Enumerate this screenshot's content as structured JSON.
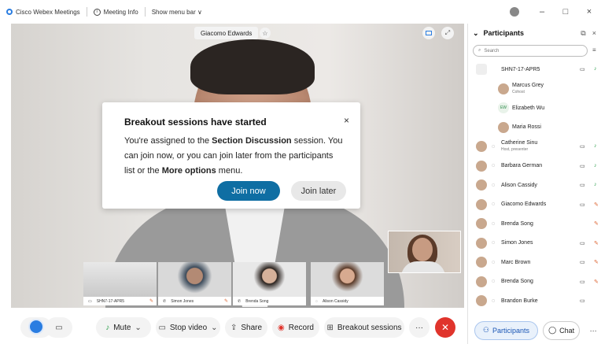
{
  "titlebar": {
    "app_name": "Cisco Webex Meetings",
    "meeting_info": "Meeting Info",
    "show_menu_bar": "Show menu bar ∨",
    "minimize": "–",
    "maximize": "□",
    "close": "×"
  },
  "stage": {
    "speaker_name": "Giacomo Edwards"
  },
  "modal": {
    "title": "Breakout sessions have started",
    "body_pre": "You're assigned to the ",
    "body_session": "Section Discussion",
    "body_mid": " session. You can join now, or you can join later from the participants list or the ",
    "body_more": "More options",
    "body_post": " menu.",
    "join_now": "Join now",
    "join_later": "Join later",
    "close": "×"
  },
  "thumbnails": [
    {
      "label": "SHN7-17-APR5"
    },
    {
      "label": "Simon Jones"
    },
    {
      "label": "Brenda Song"
    },
    {
      "label": "Alison Cassidy"
    }
  ],
  "controls": {
    "mute": "Mute",
    "stop_video": "Stop video",
    "share": "Share",
    "record": "Record",
    "breakout": "Breakout sessions",
    "more": "···",
    "end": "✕"
  },
  "panel": {
    "title": "Participants",
    "search_placeholder": "Search",
    "participants": [
      {
        "name": "SHN7-17-APR5",
        "sub": "",
        "type": "device",
        "video": true,
        "mic": "on"
      },
      {
        "name": "Marcus Grey",
        "sub": "Cohost",
        "type": "child",
        "video": false,
        "mic": ""
      },
      {
        "name": "Elizabeth Wu",
        "sub": "",
        "type": "child-init",
        "initials": "EW",
        "video": false,
        "mic": ""
      },
      {
        "name": "Maria Rossi",
        "sub": "",
        "type": "child",
        "video": false,
        "mic": ""
      },
      {
        "name": "Catherine Sinu",
        "sub": "Host, presenter",
        "type": "person",
        "video": true,
        "mic": "on"
      },
      {
        "name": "Barbara German",
        "sub": "",
        "type": "person",
        "video": true,
        "mic": "on"
      },
      {
        "name": "Alison Cassidy",
        "sub": "",
        "type": "person",
        "video": true,
        "mic": "on"
      },
      {
        "name": "Giacomo Edwards",
        "sub": "",
        "type": "person",
        "video": true,
        "mic": "off"
      },
      {
        "name": "Brenda Song",
        "sub": "",
        "type": "person",
        "video": false,
        "mic": "off"
      },
      {
        "name": "Simon Jones",
        "sub": "",
        "type": "person",
        "video": true,
        "mic": "off"
      },
      {
        "name": "Marc Brown",
        "sub": "",
        "type": "person",
        "video": true,
        "mic": "off"
      },
      {
        "name": "Brenda Song",
        "sub": "",
        "type": "person",
        "video": true,
        "mic": "off"
      },
      {
        "name": "Brandon Burke",
        "sub": "",
        "type": "person",
        "video": true,
        "mic": ""
      }
    ],
    "footer": {
      "participants": "Participants",
      "chat": "Chat",
      "more": "···"
    }
  }
}
